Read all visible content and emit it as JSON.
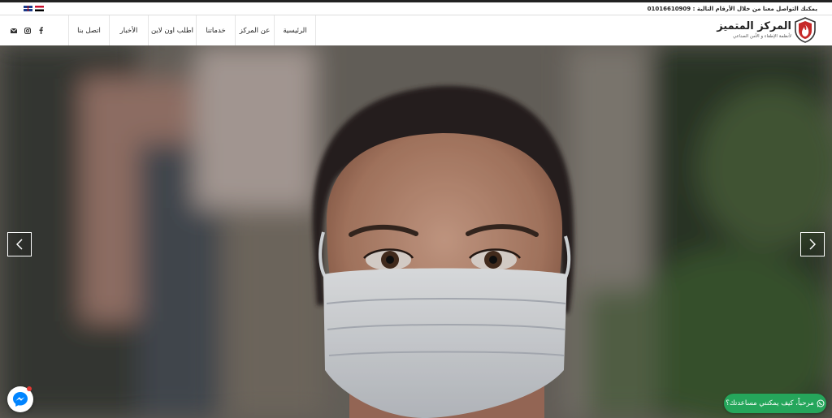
{
  "topbar": {
    "languages": [
      {
        "name": "english-flag"
      },
      {
        "name": "arabic-flag"
      }
    ],
    "contact_text": "يمكنك التواصل معنا من خلال الأرقام التالية : 01016610909"
  },
  "logo": {
    "title": "المركز المتميز",
    "subtitle": "لأنظمة الإطفاء و الأمن الصناعي"
  },
  "nav": {
    "items": [
      {
        "label": "الرئيسية",
        "name": "home"
      },
      {
        "label": "عن المركز",
        "name": "about"
      },
      {
        "label": "خدماتنا",
        "name": "services"
      },
      {
        "label": "اطلب اون لاين",
        "name": "order-online"
      },
      {
        "label": "الأخبار",
        "name": "news"
      },
      {
        "label": "اتصل بنا",
        "name": "contact"
      }
    ]
  },
  "social": {
    "icons": [
      "facebook-icon",
      "instagram-icon",
      "email-icon"
    ]
  },
  "slider": {
    "prev_icon": "chevron-left-icon",
    "next_icon": "chevron-right-icon"
  },
  "chat": {
    "messenger_icon": "messenger-icon",
    "whatsapp_icon": "whatsapp-icon",
    "whatsapp_text": "مرحباً، كيف يمكنني مساعدتك؟"
  },
  "colors": {
    "logo_red": "#c62828",
    "whatsapp_green": "#25a65b",
    "messenger_blue": "#0084ff"
  }
}
